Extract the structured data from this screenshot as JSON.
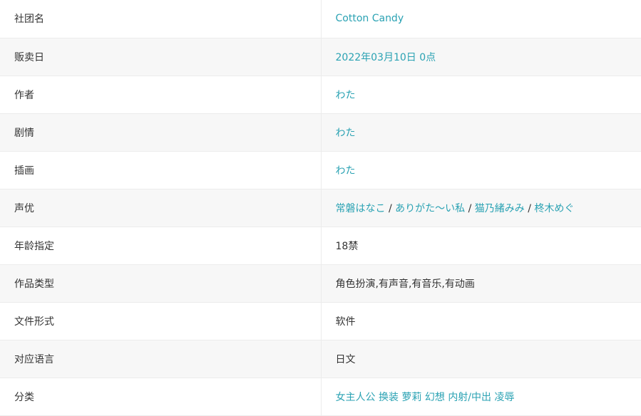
{
  "rows": [
    {
      "label": "社团名",
      "value_link": "Cotton Candy"
    },
    {
      "label": "贩卖日",
      "value_link": "2022年03月10日 0点"
    },
    {
      "label": "作者",
      "value_link": "わた"
    },
    {
      "label": "剧情",
      "value_link": "わた"
    },
    {
      "label": "插画",
      "value_link": "わた"
    },
    {
      "label": "声优",
      "voice_actors": [
        "常磐はなこ",
        "ありがた～い私",
        "猫乃緒みみ",
        "柊木めぐ"
      ],
      "separator": " / "
    },
    {
      "label": "年龄指定",
      "value_text": "18禁"
    },
    {
      "label": "作品类型",
      "value_text": "角色扮演,有声音,有音乐,有动画"
    },
    {
      "label": "文件形式",
      "value_text": "软件"
    },
    {
      "label": "对应语言",
      "value_text": "日文"
    },
    {
      "label": "分类",
      "tags": [
        "女主人公",
        "换装",
        "萝莉",
        "幻想",
        "内射/中出",
        "凌辱"
      ]
    }
  ],
  "colors": {
    "link": "#2aa2b3",
    "text": "#333333",
    "stripe": "#f7f7f7",
    "border": "#ececec"
  }
}
